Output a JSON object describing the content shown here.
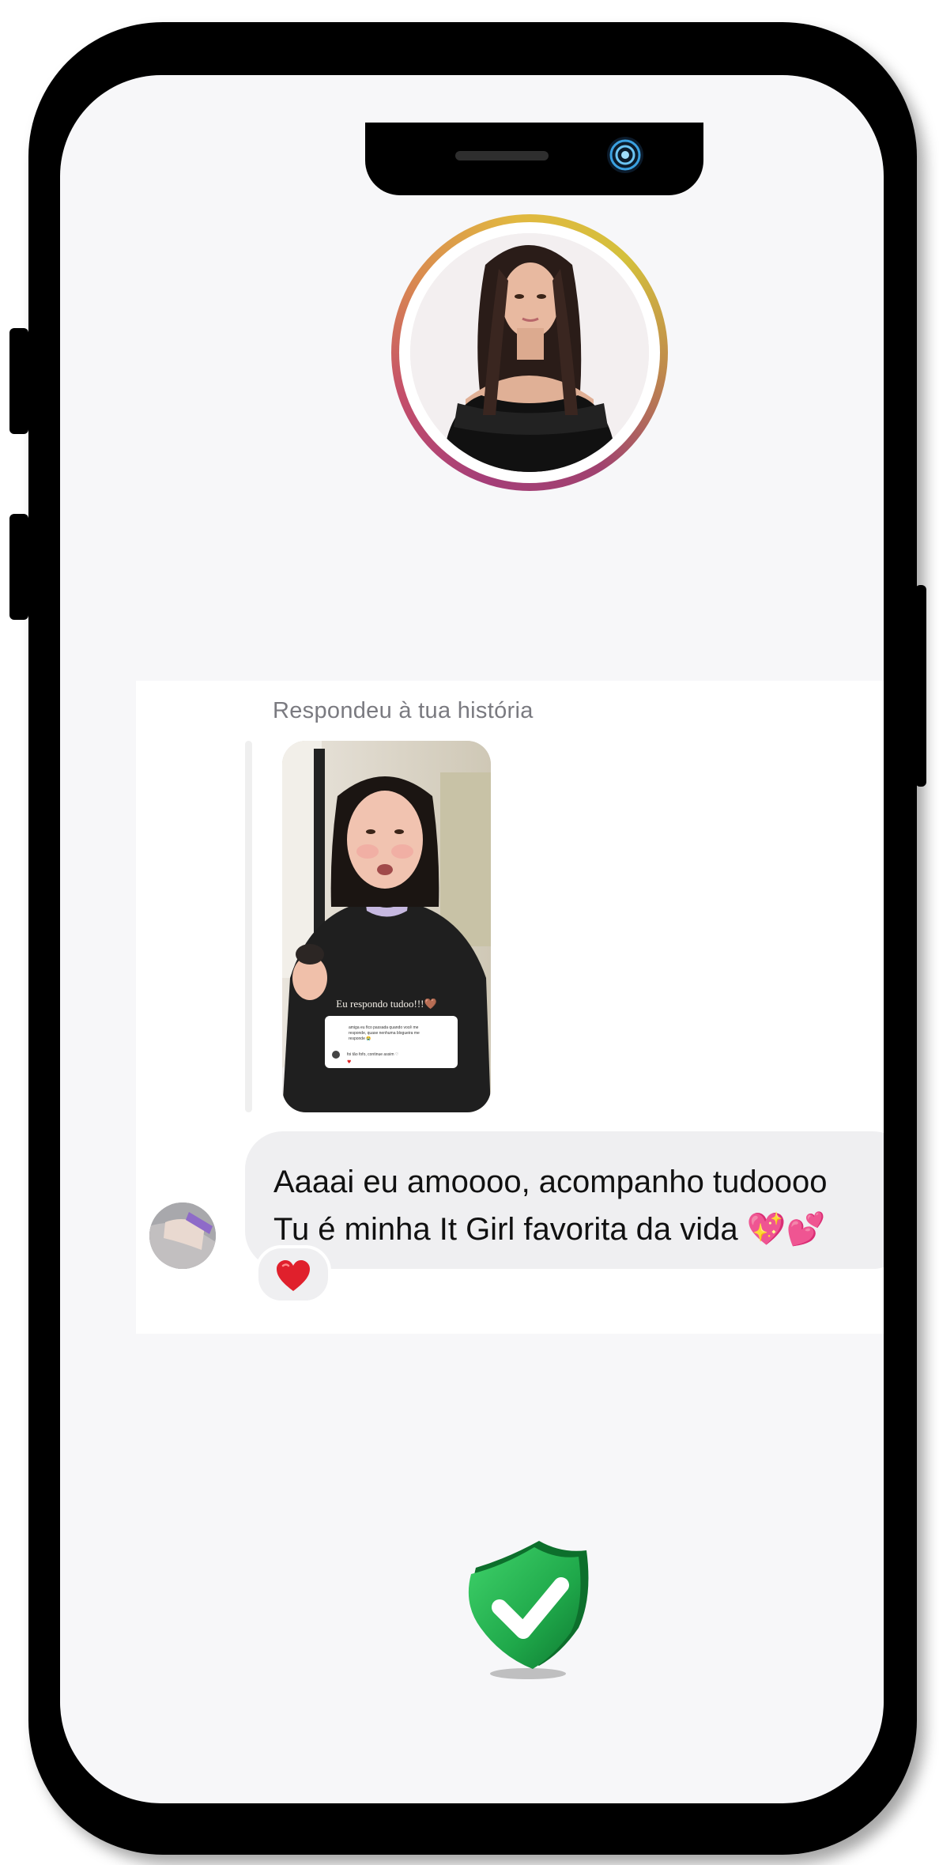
{
  "profile": {
    "avatar_icon": "profile-photo-icon"
  },
  "message": {
    "reply_label": "Respondeu à tua história",
    "story_caption": "Eu respondo tudoo!!!🤎",
    "story_comment_text": "amiga eu fico passada quando você me responde, quase nenhuma blogueira me responde 😭",
    "story_reply_text": "foi tão fofo, continue assim ♡",
    "text_line1": "Aaaai eu amoooo, acompanho tudoooo",
    "text_line2": "Tu é minha It Girl favorita da vida 💖💕",
    "reaction": "❤️"
  },
  "status": {
    "verified_icon": "shield-check-icon",
    "color": "#1fa84a"
  }
}
